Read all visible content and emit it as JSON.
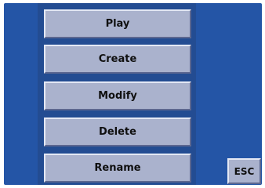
{
  "menu": {
    "items": [
      {
        "label": "Play"
      },
      {
        "label": "Create"
      },
      {
        "label": "Modify"
      },
      {
        "label": "Delete"
      },
      {
        "label": "Rename"
      }
    ]
  },
  "esc": {
    "label": "ESC"
  },
  "colors": {
    "background": "#2455a6",
    "panel": "#234c92",
    "button_face": "#aab2cd",
    "button_highlight": "#e4e8f4",
    "button_shadow": "#5c6790"
  }
}
